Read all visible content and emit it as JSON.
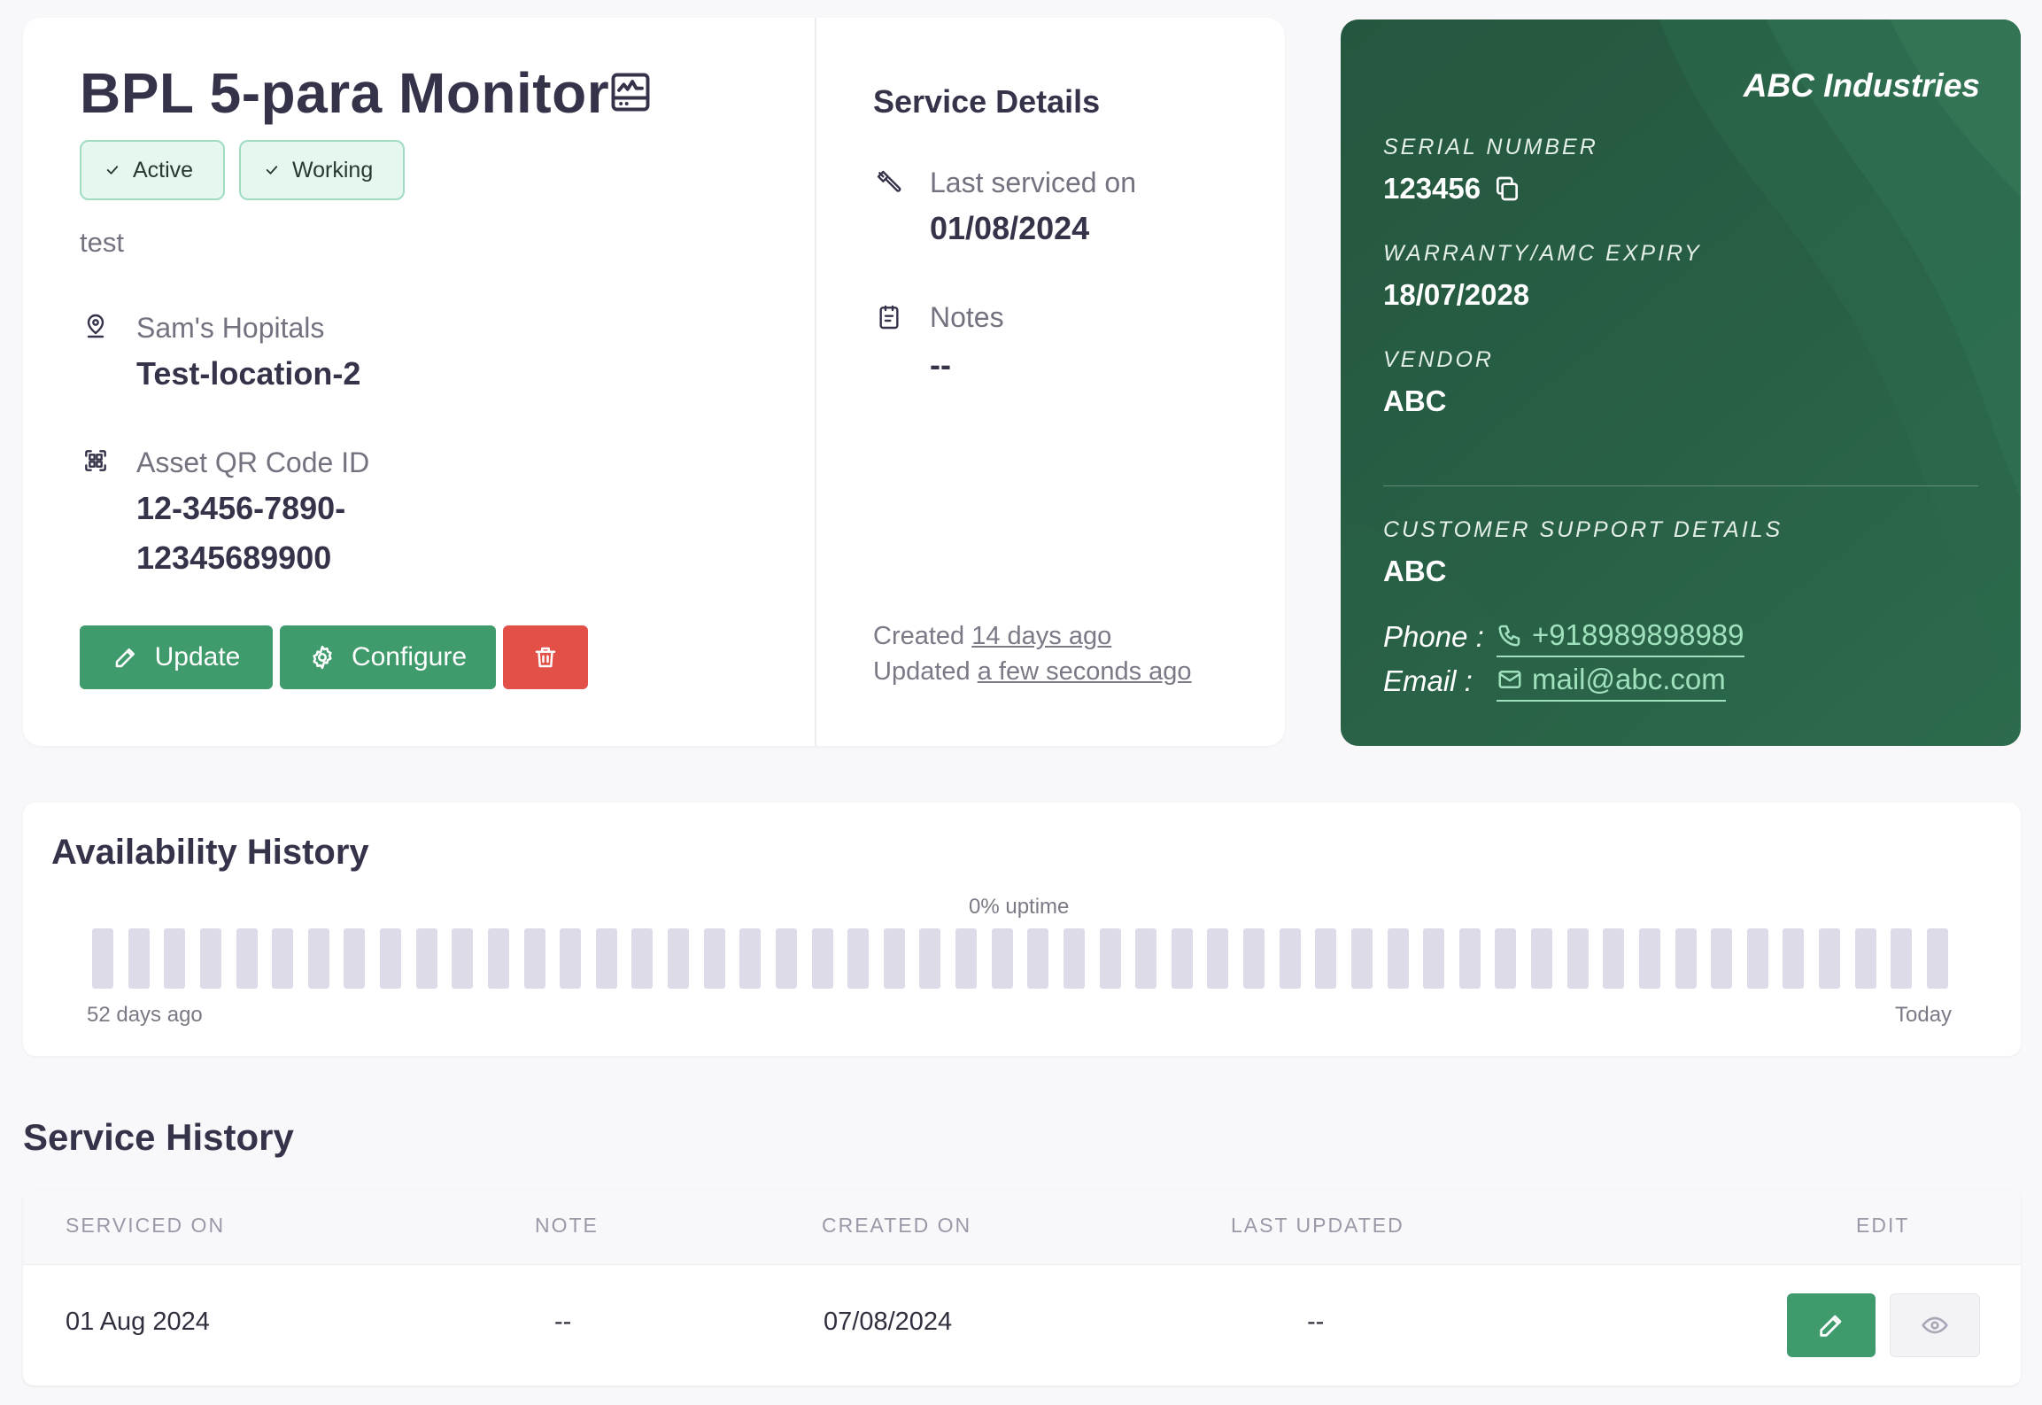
{
  "asset": {
    "title": "BPL 5-para Monitor",
    "badges": [
      "Active",
      "Working"
    ],
    "description": "test",
    "location_label": "Sam's Hopitals",
    "location_value": "Test-location-2",
    "qr_label": "Asset QR Code ID",
    "qr_value_line1": "12-3456-7890-",
    "qr_value_line2": "12345689900"
  },
  "actions": {
    "update_label": "Update",
    "configure_label": "Configure"
  },
  "service_details": {
    "title": "Service Details",
    "last_serviced_label": "Last serviced on",
    "last_serviced_value": "01/08/2024",
    "notes_label": "Notes",
    "notes_value": "--",
    "created_prefix": "Created",
    "created_value": "14 days ago",
    "updated_prefix": "Updated",
    "updated_value": "a few seconds ago"
  },
  "vendor_card": {
    "brand": "ABC Industries",
    "serial_label": "SERIAL NUMBER",
    "serial_value": "123456",
    "warranty_label": "WARRANTY/AMC EXPIRY",
    "warranty_value": "18/07/2028",
    "vendor_label": "VENDOR",
    "vendor_value": "ABC",
    "support_label": "CUSTOMER SUPPORT DETAILS",
    "support_value": "ABC",
    "phone_label": "Phone :",
    "phone_value": "+918989898989",
    "email_label": "Email :",
    "email_value": "mail@abc.com"
  },
  "availability": {
    "title": "Availability History",
    "uptime_text": "0% uptime",
    "uptime_fraction": 0,
    "bar_count": 52,
    "axis_start": "52 days ago",
    "axis_end": "Today"
  },
  "service_history": {
    "title": "Service History",
    "columns": [
      "SERVICED ON",
      "NOTE",
      "CREATED ON",
      "LAST UPDATED",
      "EDIT"
    ],
    "rows": [
      {
        "serviced_on": "01 Aug 2024",
        "note": "--",
        "created_on": "07/08/2024",
        "last_updated": "--"
      }
    ]
  },
  "colors": {
    "primary_green": "#3f9a6c",
    "danger_red": "#e25048",
    "vendor_card_bg": "#24573f",
    "uptime_bar_empty": "#dddbe8"
  }
}
